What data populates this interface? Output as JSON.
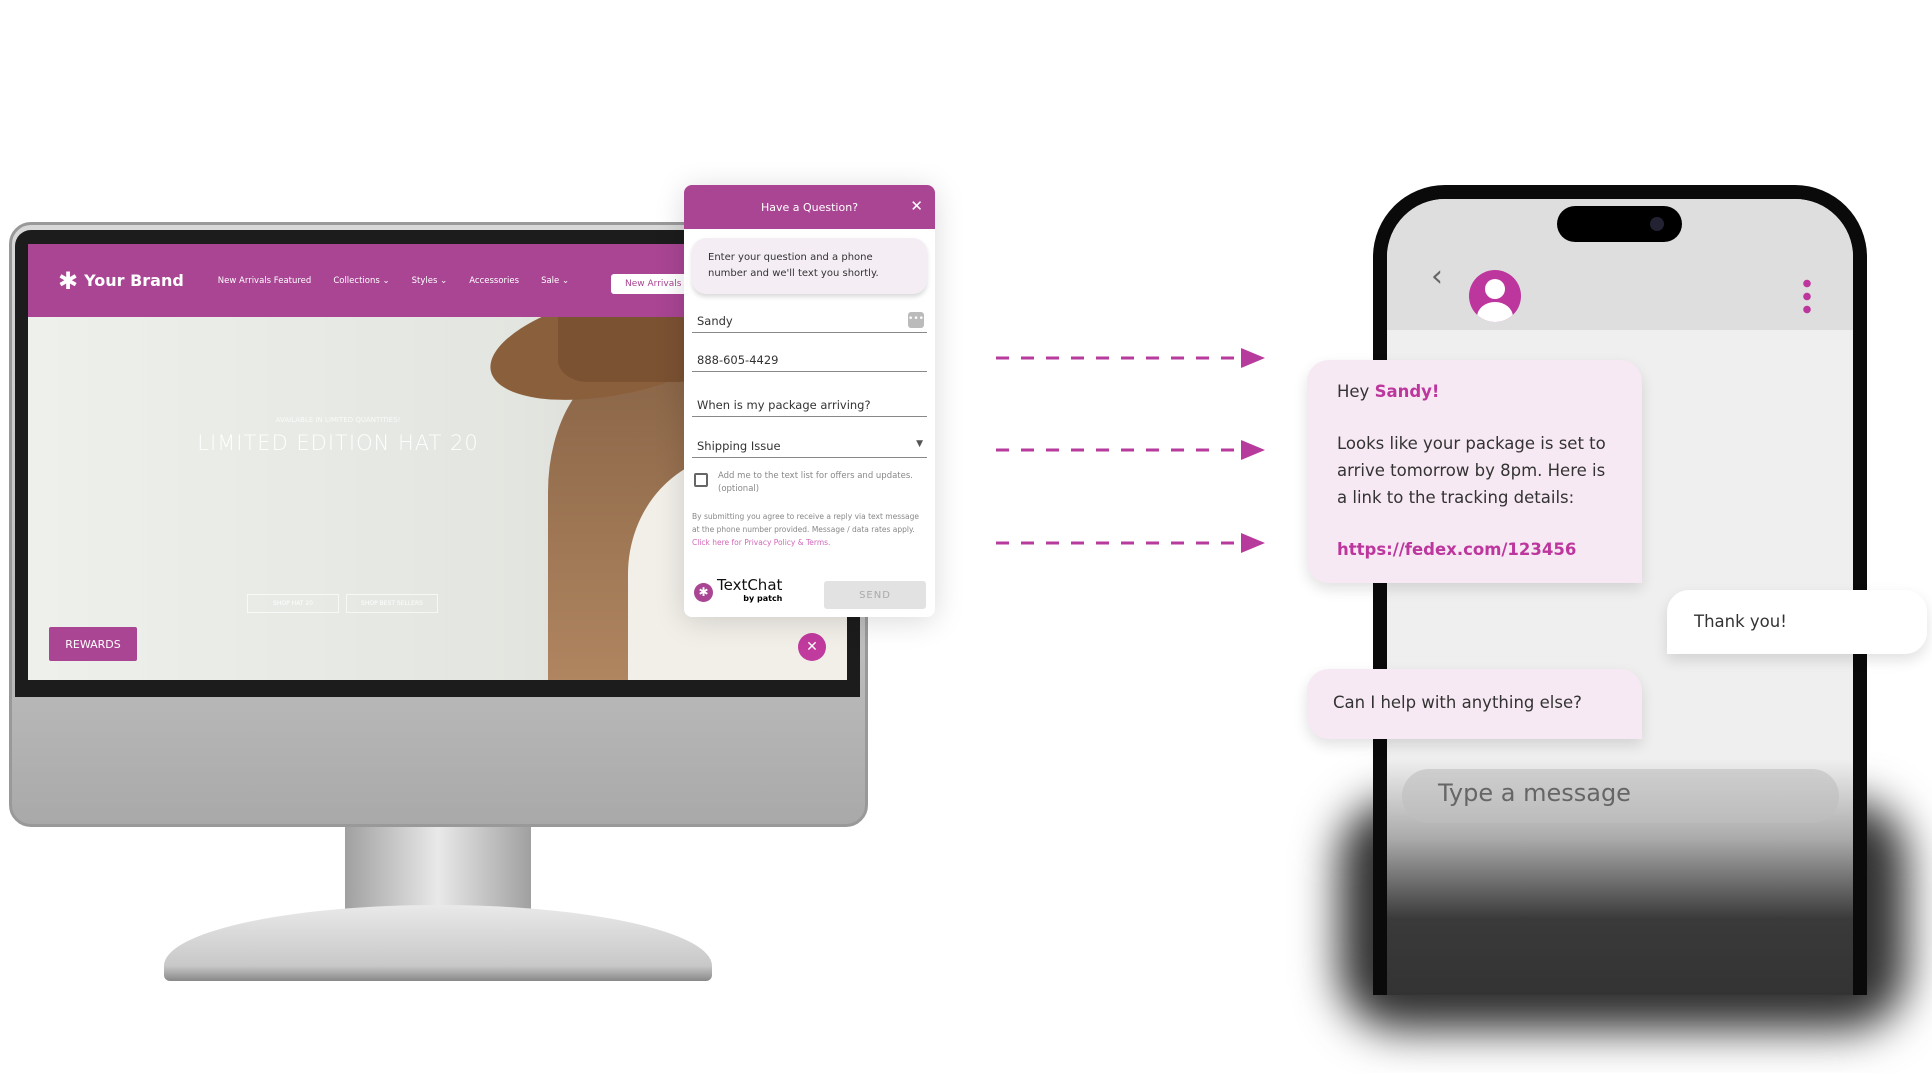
{
  "website": {
    "brand": "Your Brand",
    "nav": [
      "New Arrivals Featured",
      "Collections",
      "Styles",
      "Accessories",
      "Sale"
    ],
    "nav_button": "New Arrivals",
    "hero_kicker": "AVAILABLE IN LIMITED QUANTITIES!",
    "hero_title": "LIMITED EDITION HAT 20",
    "hero_buttons": [
      "SHOP HAT 20",
      "SHOP BEST SELLERS"
    ],
    "rewards": "REWARDS"
  },
  "chat_widget": {
    "title": "Have a Question?",
    "intro": "Enter your question and a phone number and we'll text you shortly.",
    "name_value": "Sandy",
    "phone_value": "888-605-4429",
    "question_value": "When is my package arriving?",
    "topic_value": "Shipping Issue",
    "optin_label": "Add me to the text list for offers and updates. (optional)",
    "disclaimer": "By submitting you agree to receive a reply via text message at the phone number provided. Message / data rates apply. ",
    "privacy_link": "Click here for Privacy Policy & Terms.",
    "logo_name": "TextChat",
    "logo_by": "by patch",
    "send": "SEND",
    "accent": "#a94593"
  },
  "phone": {
    "msg1_greeting": "Hey ",
    "msg1_name": "Sandy!",
    "msg1_body": "Looks like your package is set to arrive tomorrow by 8pm. Here is a link to the tracking details:",
    "msg1_link": "https://fedex.com/123456",
    "reply": "Thank you!",
    "msg2": "Can I help with anything else?",
    "input_placeholder": "Type a message"
  }
}
